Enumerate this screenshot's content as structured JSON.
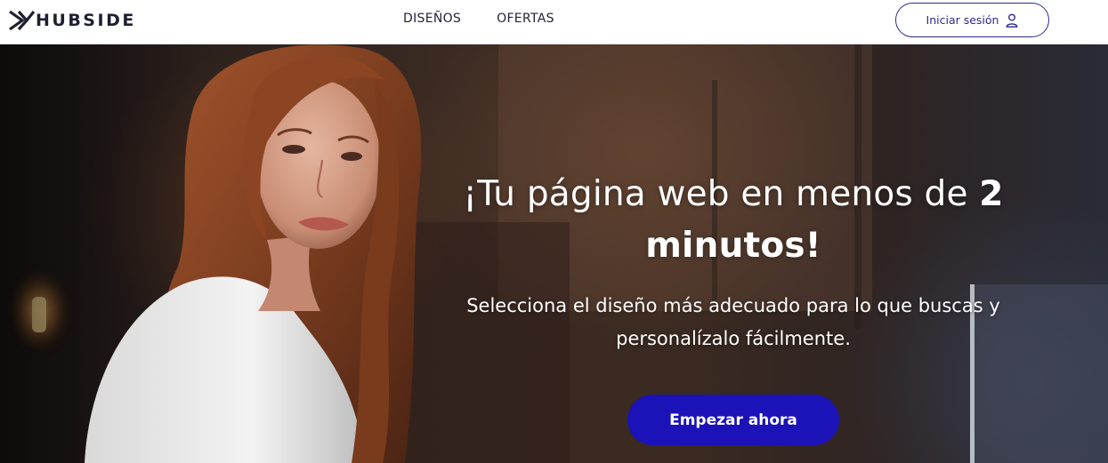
{
  "brand": {
    "name": "HUBSIDE",
    "accent": "#1b12b8",
    "logo_icon": "hubside-x-logo-icon"
  },
  "nav": {
    "items": [
      {
        "label": "DISEÑOS"
      },
      {
        "label": "OFERTAS"
      }
    ]
  },
  "header": {
    "login_label": "Iniciar sesión",
    "login_icon": "user-icon"
  },
  "hero": {
    "title_regular": "¡Tu página web en menos de ",
    "title_bold": "2 minutos!",
    "subtitle_line1": "Selecciona el diseño más adecuado para lo que buscas y",
    "subtitle_line2": "personalízalo fácilmente.",
    "cta_label": "Empezar ahora",
    "background_image": "woman-smiling-laptop-cafe-photo"
  }
}
